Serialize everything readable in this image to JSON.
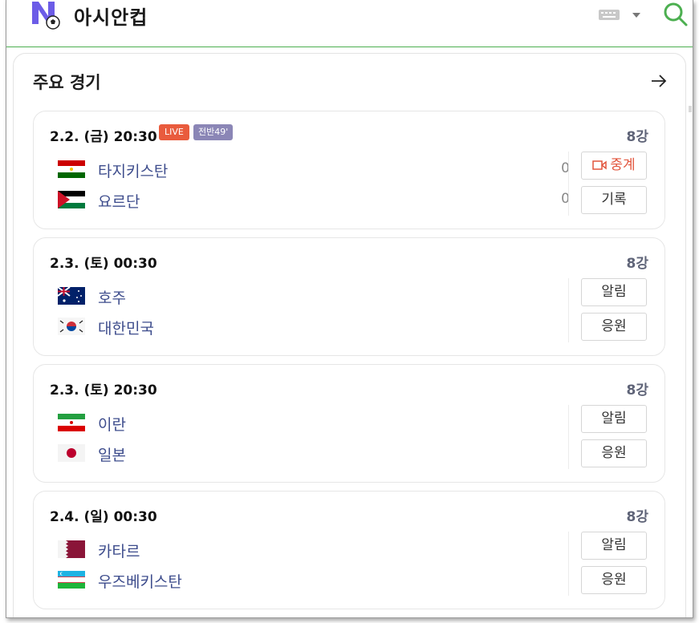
{
  "header": {
    "title": "아시안컵",
    "logo_icon": "naver-soccer-logo-icon",
    "keyboard_icon": "keyboard-icon",
    "search_icon": "search-icon",
    "accent_color": "#4caf50"
  },
  "section": {
    "title": "주요 경기",
    "more_icon": "arrow-right-icon"
  },
  "matches": [
    {
      "date": "2.2. (금) 20:30",
      "live_badge": "LIVE",
      "period_badge": "전반49'",
      "round": "8강",
      "home": {
        "name": "타지키스탄",
        "flag": "tajikistan-flag-icon",
        "score": "0"
      },
      "away": {
        "name": "요르단",
        "flag": "jordan-flag-icon",
        "score": "0"
      },
      "button1": "중계",
      "button2": "기록"
    },
    {
      "date": "2.3. (토) 00:30",
      "round": "8강",
      "home": {
        "name": "호주",
        "flag": "australia-flag-icon"
      },
      "away": {
        "name": "대한민국",
        "flag": "korea-flag-icon"
      },
      "button1": "알림",
      "button2": "응원"
    },
    {
      "date": "2.3. (토) 20:30",
      "round": "8강",
      "home": {
        "name": "이란",
        "flag": "iran-flag-icon"
      },
      "away": {
        "name": "일본",
        "flag": "japan-flag-icon"
      },
      "button1": "알림",
      "button2": "응원"
    },
    {
      "date": "2.4. (일) 00:30",
      "round": "8강",
      "home": {
        "name": "카타르",
        "flag": "qatar-flag-icon"
      },
      "away": {
        "name": "우즈베키스탄",
        "flag": "uzbekistan-flag-icon"
      },
      "button1": "알림",
      "button2": "응원"
    }
  ],
  "colors": {
    "live": "#e95b3d",
    "period": "#8b86b6",
    "team_name": "#3d4c8c",
    "round": "#5f6478"
  }
}
